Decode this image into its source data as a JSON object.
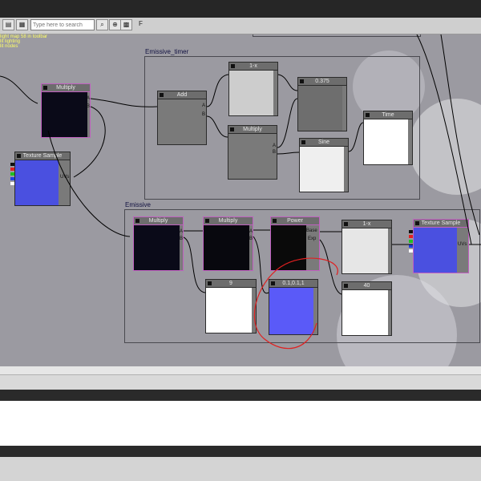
{
  "toolbar": {
    "search_placeholder": "Type here to search",
    "btn_f": "F"
  },
  "overlay": {
    "lines": [
      "light map 58 in toolbar",
      "lit lighting",
      "lit nodes"
    ]
  },
  "groups": {
    "timer": "Emissive_timer",
    "emissive": "Emissive"
  },
  "nodes": {
    "multiply_top": "Multiply",
    "texture_left": "Texture Sample",
    "add": "Add",
    "one_minus_x_top": "1-x",
    "value_0375": "0.375",
    "multiply_timer": "Multiply",
    "time": "Time",
    "sine": "Sine",
    "multiply_e1": "Multiply",
    "multiply_e2": "Multiply",
    "power": "Power",
    "one_minus_x_e": "1-x",
    "texture_right": "Texture Sample",
    "value_9": "9",
    "const_color": "0.1,0.1,1",
    "value_40": "40"
  },
  "pins": {
    "a": "A",
    "b": "B",
    "base": "Base",
    "exp": "Exp",
    "uvs": "UVs"
  },
  "colors": {
    "constant_color": "#5a5af8",
    "annotation": "#e02020",
    "canvas": "#9b9aa1"
  }
}
